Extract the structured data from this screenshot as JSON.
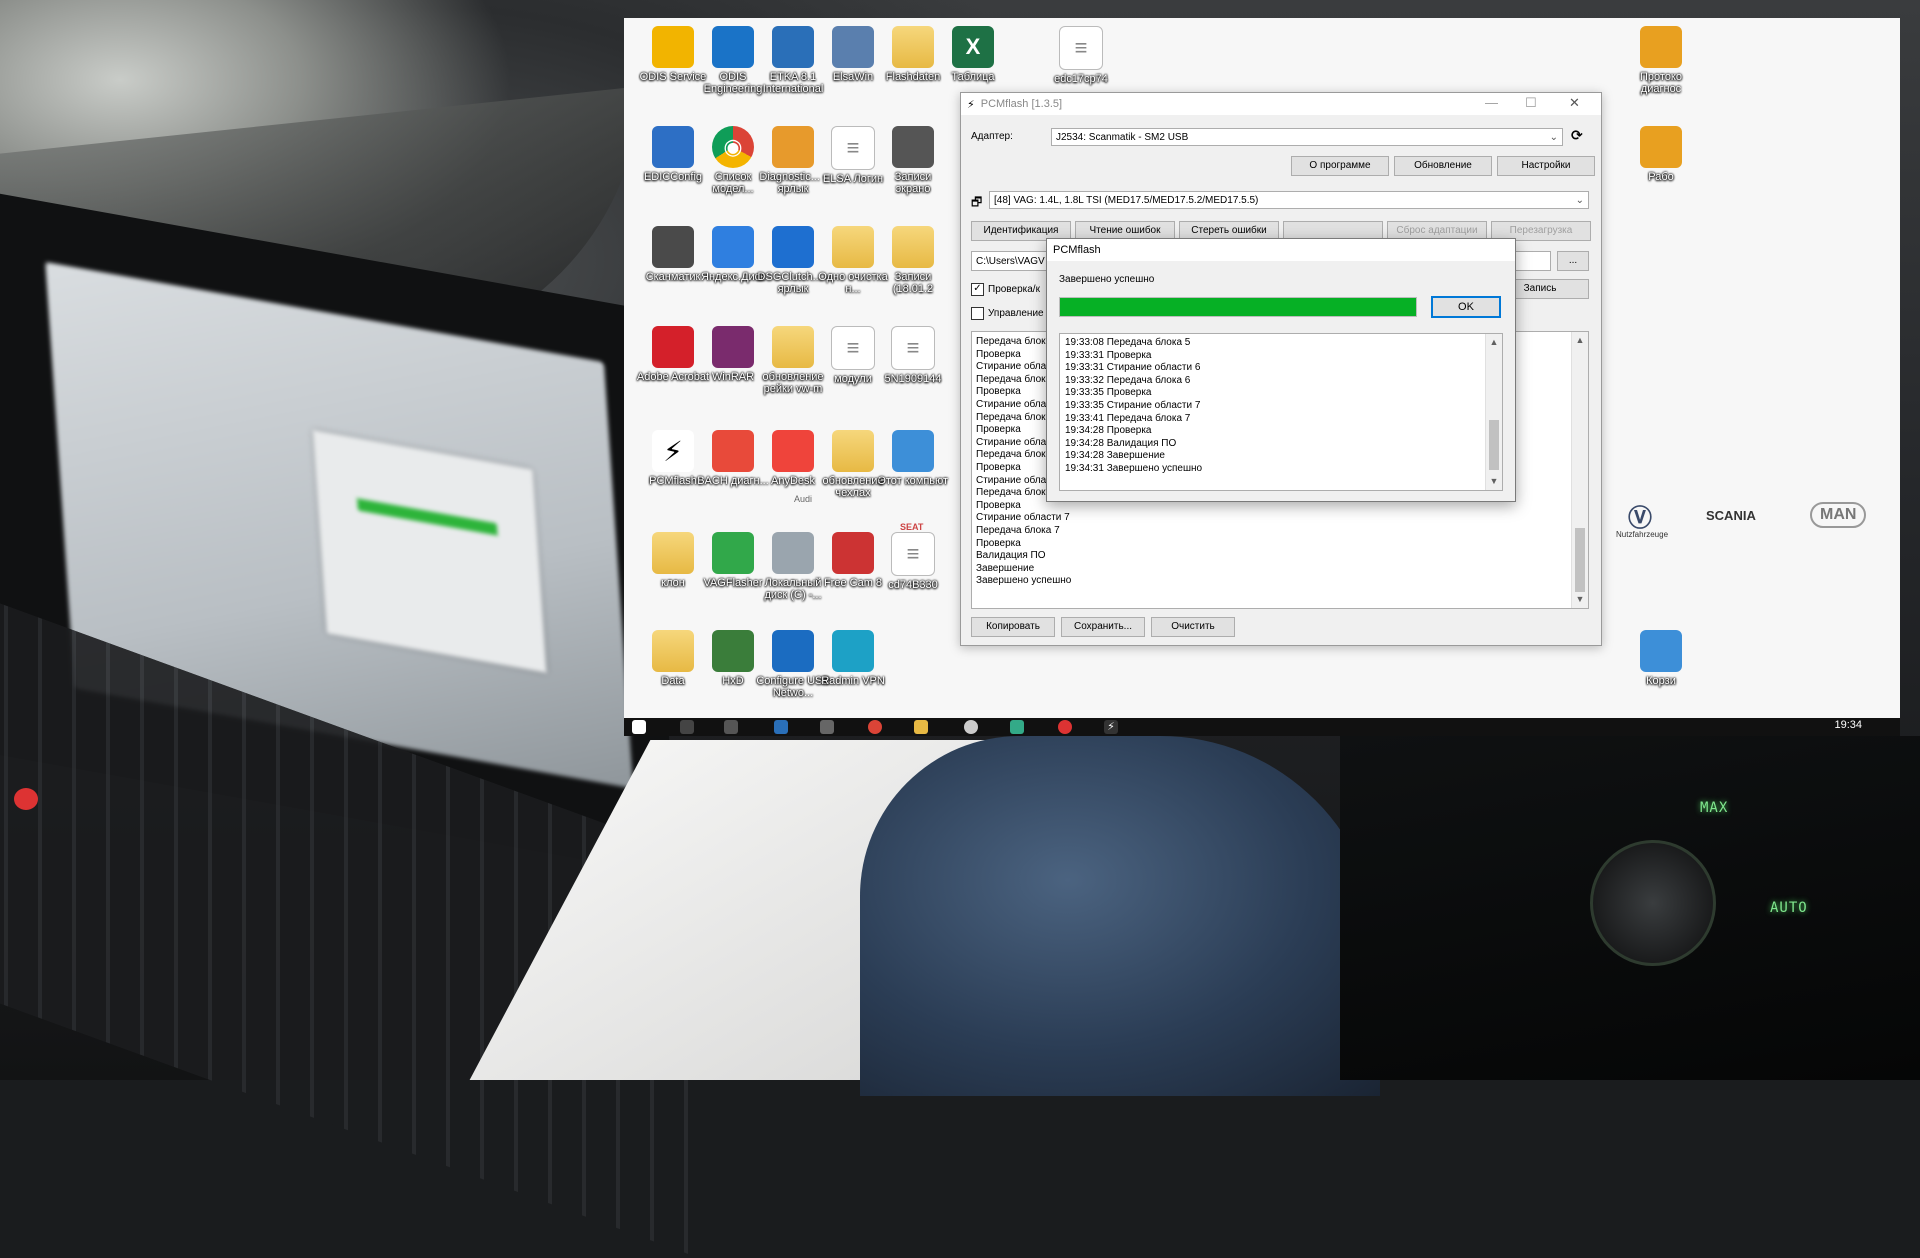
{
  "desktop": {
    "icons": [
      {
        "label": "ODIS Service",
        "kind": "app",
        "color": "#f2b400"
      },
      {
        "label": "ODIS Engineering",
        "kind": "app",
        "color": "#1a73c7"
      },
      {
        "label": "ETKA 8.1 International",
        "kind": "app",
        "color": "#2a6fb8"
      },
      {
        "label": "ElsaWin",
        "kind": "app",
        "color": "#5a7fae"
      },
      {
        "label": "Flashdaten",
        "kind": "folder",
        "color": "#e7b944"
      },
      {
        "label": "Таблица",
        "kind": "excel",
        "color": "#1e7145"
      },
      {
        "label": "edc17cp74",
        "kind": "doc",
        "color": "#ffffff"
      },
      {
        "label": "Протоко диагнос",
        "kind": "app",
        "color": "#e8a020"
      },
      {
        "label": "EDICConfig",
        "kind": "app",
        "color": "#2d6fc5"
      },
      {
        "label": "Список модел...",
        "kind": "chrome",
        "color": "#4285f4"
      },
      {
        "label": "Diagnostic... - ярлык",
        "kind": "app",
        "color": "#e79a2c"
      },
      {
        "label": "ELSA Логин",
        "kind": "doc",
        "color": "#ffffff"
      },
      {
        "label": "Записи экрано",
        "kind": "app",
        "color": "#555555"
      },
      {
        "label": "Рабо",
        "kind": "app",
        "color": "#e8a020"
      },
      {
        "label": "Сканматик",
        "kind": "app",
        "color": "#4a4a4a"
      },
      {
        "label": "Яндекс.Диск",
        "kind": "app",
        "color": "#2f7fe0"
      },
      {
        "label": "DSGClutch... - ярлык",
        "kind": "app",
        "color": "#1e6fd0"
      },
      {
        "label": "Одно очистка н...",
        "kind": "folder",
        "color": "#e7b944"
      },
      {
        "label": "Записи (18.01.2",
        "kind": "folder",
        "color": "#e7b944"
      },
      {
        "label": "Adobe Acrobat",
        "kind": "app",
        "color": "#d4202a"
      },
      {
        "label": "WinRAR",
        "kind": "app",
        "color": "#7a2b6d"
      },
      {
        "label": "обновление рейки vw-m",
        "kind": "folder",
        "color": "#e7b944"
      },
      {
        "label": "модули",
        "kind": "doc",
        "color": "#ffffff"
      },
      {
        "label": "5N1909144",
        "kind": "doc",
        "color": "#ffffff"
      },
      {
        "label": "PCMflash",
        "kind": "pcm",
        "color": "#ffffff"
      },
      {
        "label": "BACH диагн...",
        "kind": "app",
        "color": "#e84a3a"
      },
      {
        "label": "AnyDesk",
        "kind": "app",
        "color": "#ef443b"
      },
      {
        "label": "обновление чехлах",
        "kind": "folder",
        "color": "#e7b944"
      },
      {
        "label": "Этот компьют",
        "kind": "app",
        "color": "#3d8fd8"
      },
      {
        "label": "клон",
        "kind": "folder",
        "color": "#e7b944"
      },
      {
        "label": "VAGFlasher",
        "kind": "app",
        "color": "#31a84a"
      },
      {
        "label": "Локальный диск (C) -...",
        "kind": "app",
        "color": "#9aa5ae"
      },
      {
        "label": "Free Cam 8",
        "kind": "app",
        "color": "#cc3333"
      },
      {
        "label": "cd74B330",
        "kind": "doc",
        "color": "#ffffff"
      },
      {
        "label": "Data",
        "kind": "folder",
        "color": "#e7b944"
      },
      {
        "label": "HxD",
        "kind": "app",
        "color": "#3a7d3a"
      },
      {
        "label": "Configure USB Netwo...",
        "kind": "app",
        "color": "#1b6cc1"
      },
      {
        "label": "Radmin VPN",
        "kind": "app",
        "color": "#1da1c6"
      },
      {
        "label": "Корзи",
        "kind": "app",
        "color": "#3d8fd8"
      }
    ],
    "brands": {
      "vw": "Nutzfahrzeuge",
      "scania": "SCANIA",
      "man": "MAN",
      "audi": "Audi",
      "seat": "SEAT"
    },
    "taskbar": {
      "clock": "19:34"
    }
  },
  "pcmflash": {
    "title": "PCMflash [1.3.5]",
    "adapter_label": "Адаптер:",
    "adapter_value": "J2534: Scanmatik - SM2 USB",
    "buttons": {
      "about": "О программе",
      "update": "Обновление",
      "settings": "Настройки"
    },
    "module_value": "[48] VAG: 1.4L, 1.8L TSI (MED17.5/MED17.5.2/MED17.5.5)",
    "tabs": {
      "ident": "Идентификация",
      "read_dtc": "Чтение ошибок",
      "clear_dtc": "Стереть ошибки",
      "reset_adapt": "Сброс адаптации",
      "reboot": "Перезагрузка"
    },
    "path_value": "C:\\Users\\VAGV",
    "browse": "...",
    "write_button": "Запись",
    "check_label": "Проверка/к",
    "control_label": "Управление",
    "log": [
      "Передача блока",
      "Проверка",
      "Стирание обла",
      "Передача блок",
      "Проверка",
      "Стирание обла",
      "Передача блок",
      "Проверка",
      "Стирание обла",
      "Передача блок",
      "Проверка",
      "Стирание обла",
      "Передача блок",
      "Проверка",
      "Стирание области 7",
      "Передача блока 7",
      "Проверка",
      "Валидация ПО",
      "Завершение",
      "Завершено успешно"
    ],
    "bottom_buttons": {
      "copy": "Копировать",
      "save": "Сохранить...",
      "clear": "Очистить"
    }
  },
  "dialog": {
    "title": "PCMflash",
    "message": "Завершено успешно",
    "progress": 1.0,
    "progress_color": "#06b025",
    "ok": "OK",
    "log": [
      "19:33:08 Передача блока 5",
      "19:33:31 Проверка",
      "19:33:31 Стирание области 6",
      "19:33:32 Передача блока 6",
      "19:33:35 Проверка",
      "19:33:35 Стирание области 7",
      "19:33:41 Передача блока 7",
      "19:34:28 Проверка",
      "19:34:28 Валидация ПО",
      "19:34:28 Завершение",
      "19:34:31 Завершено успешно"
    ]
  }
}
